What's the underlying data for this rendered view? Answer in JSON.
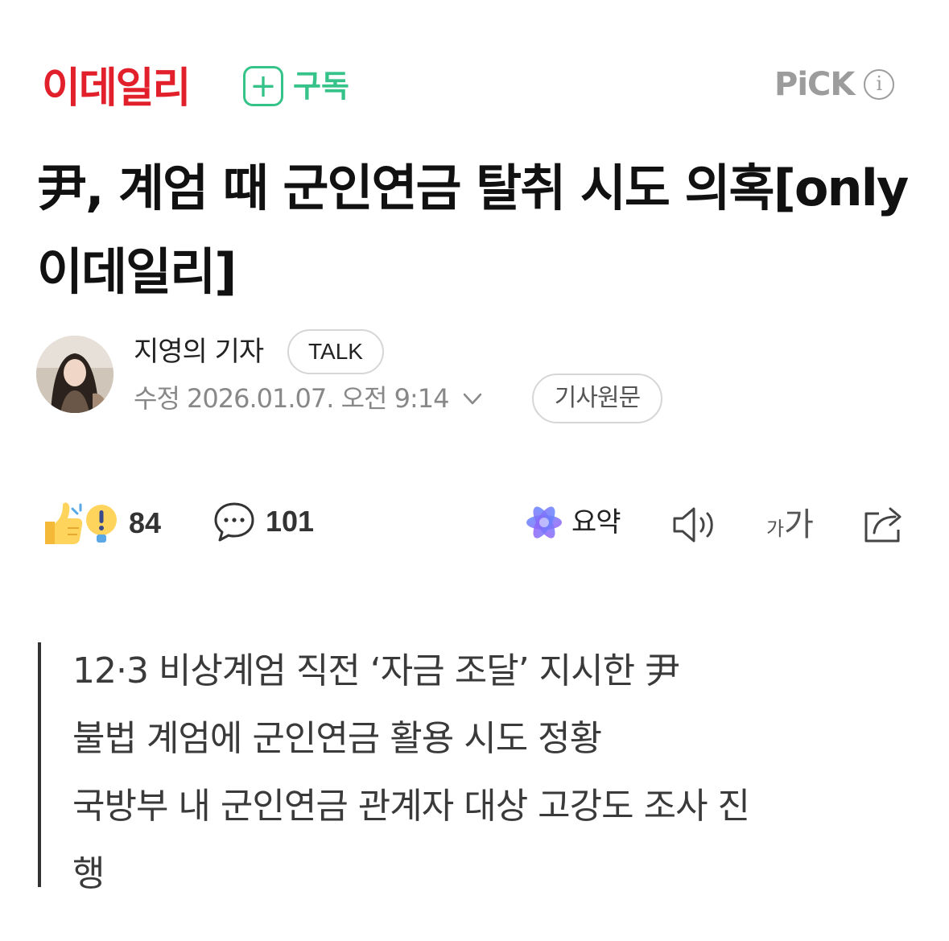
{
  "header": {
    "press_name": "이데일리",
    "subscribe_label": "구독",
    "pick_label": "PiCK",
    "info_glyph": "i",
    "press_color": "#e2202b",
    "subscribe_color": "#36c389"
  },
  "article": {
    "headline": "尹, 계엄 때 군인연금 탈취 시도 의혹[only 이데일리]",
    "author": "지영의 기자",
    "talk_label": "TALK",
    "date": "수정 2026.01.07. 오전 9:14",
    "original_label": "기사원문"
  },
  "actions": {
    "reaction_count": "84",
    "comment_count": "101",
    "summary_label": "요약",
    "font_small": "가",
    "font_large": "가",
    "icons": [
      "thumbs-up-icon",
      "exclamation-icon",
      "comment-icon",
      "summary-star-icon",
      "speaker-icon",
      "share-icon"
    ]
  },
  "summary_lines": [
    "12·3 비상계엄 직전 ‘자금 조달’ 지시한 尹",
    "불법 계엄에 군인연금 활용 시도 정황",
    "국방부 내 군인연금 관계자 대상 고강도 조사 진",
    "행"
  ]
}
